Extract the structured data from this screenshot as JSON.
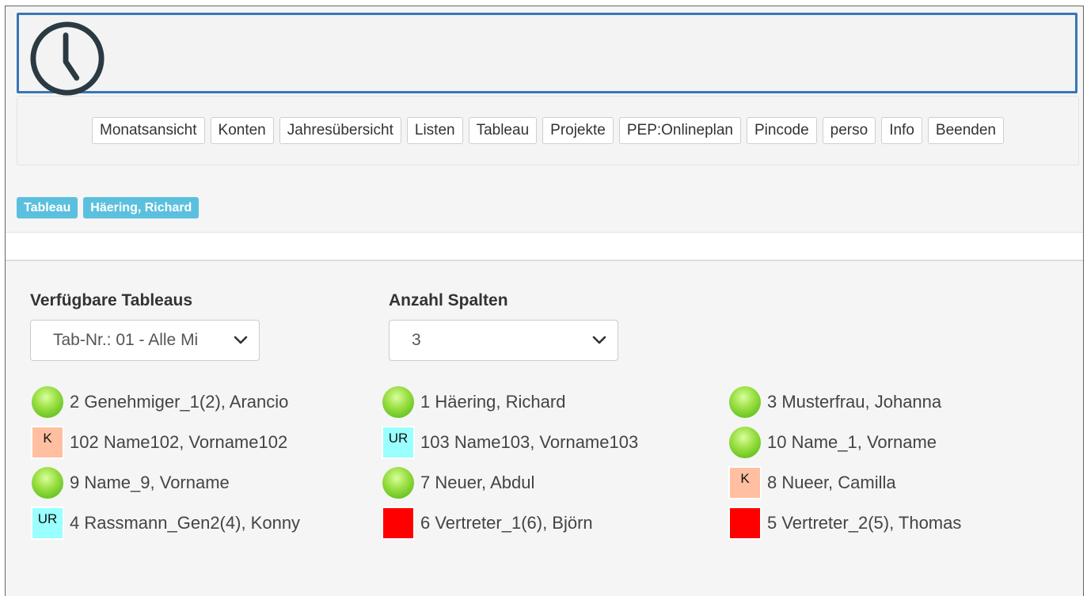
{
  "nav": {
    "items": [
      "Monatsansicht",
      "Konten",
      "Jahresübersicht",
      "Listen",
      "Tableau",
      "Projekte",
      "PEP:Onlineplan",
      "Pincode",
      "perso",
      "Info",
      "Beenden"
    ]
  },
  "breadcrumb": [
    "Tableau",
    "Häering, Richard"
  ],
  "form": {
    "tableaus_label": "Verfügbare Tableaus",
    "tableaus_value": "Tab-Nr.: 01 - Alle Mi",
    "columns_label": "Anzahl Spalten",
    "columns_value": "3"
  },
  "colors": {
    "accent": "#3a76b5",
    "badge": "#5bc0de",
    "K": "#ffbfa0",
    "UR": "#99ffff",
    "absent": "#ff0000"
  },
  "tableau": {
    "columns": [
      [
        {
          "status": "green",
          "code": "",
          "name": "2 Genehmiger_1(2), Arancio"
        },
        {
          "status": "K",
          "code": "K",
          "name": "102 Name102, Vorname102"
        },
        {
          "status": "green",
          "code": "",
          "name": "9 Name_9, Vorname"
        },
        {
          "status": "UR",
          "code": "UR",
          "name": "4 Rassmann_Gen2(4), Konny"
        }
      ],
      [
        {
          "status": "green",
          "code": "",
          "name": "1 Häering, Richard"
        },
        {
          "status": "UR",
          "code": "UR",
          "name": "103 Name103, Vorname103"
        },
        {
          "status": "green",
          "code": "",
          "name": "7 Neuer, Abdul"
        },
        {
          "status": "red",
          "code": "",
          "name": "6 Vertreter_1(6), Björn"
        }
      ],
      [
        {
          "status": "green",
          "code": "",
          "name": "3 Musterfrau, Johanna"
        },
        {
          "status": "green",
          "code": "",
          "name": "10 Name_1, Vorname"
        },
        {
          "status": "K",
          "code": "K",
          "name": "8 Nueer, Camilla"
        },
        {
          "status": "red",
          "code": "",
          "name": "5 Vertreter_2(5), Thomas"
        }
      ]
    ]
  }
}
